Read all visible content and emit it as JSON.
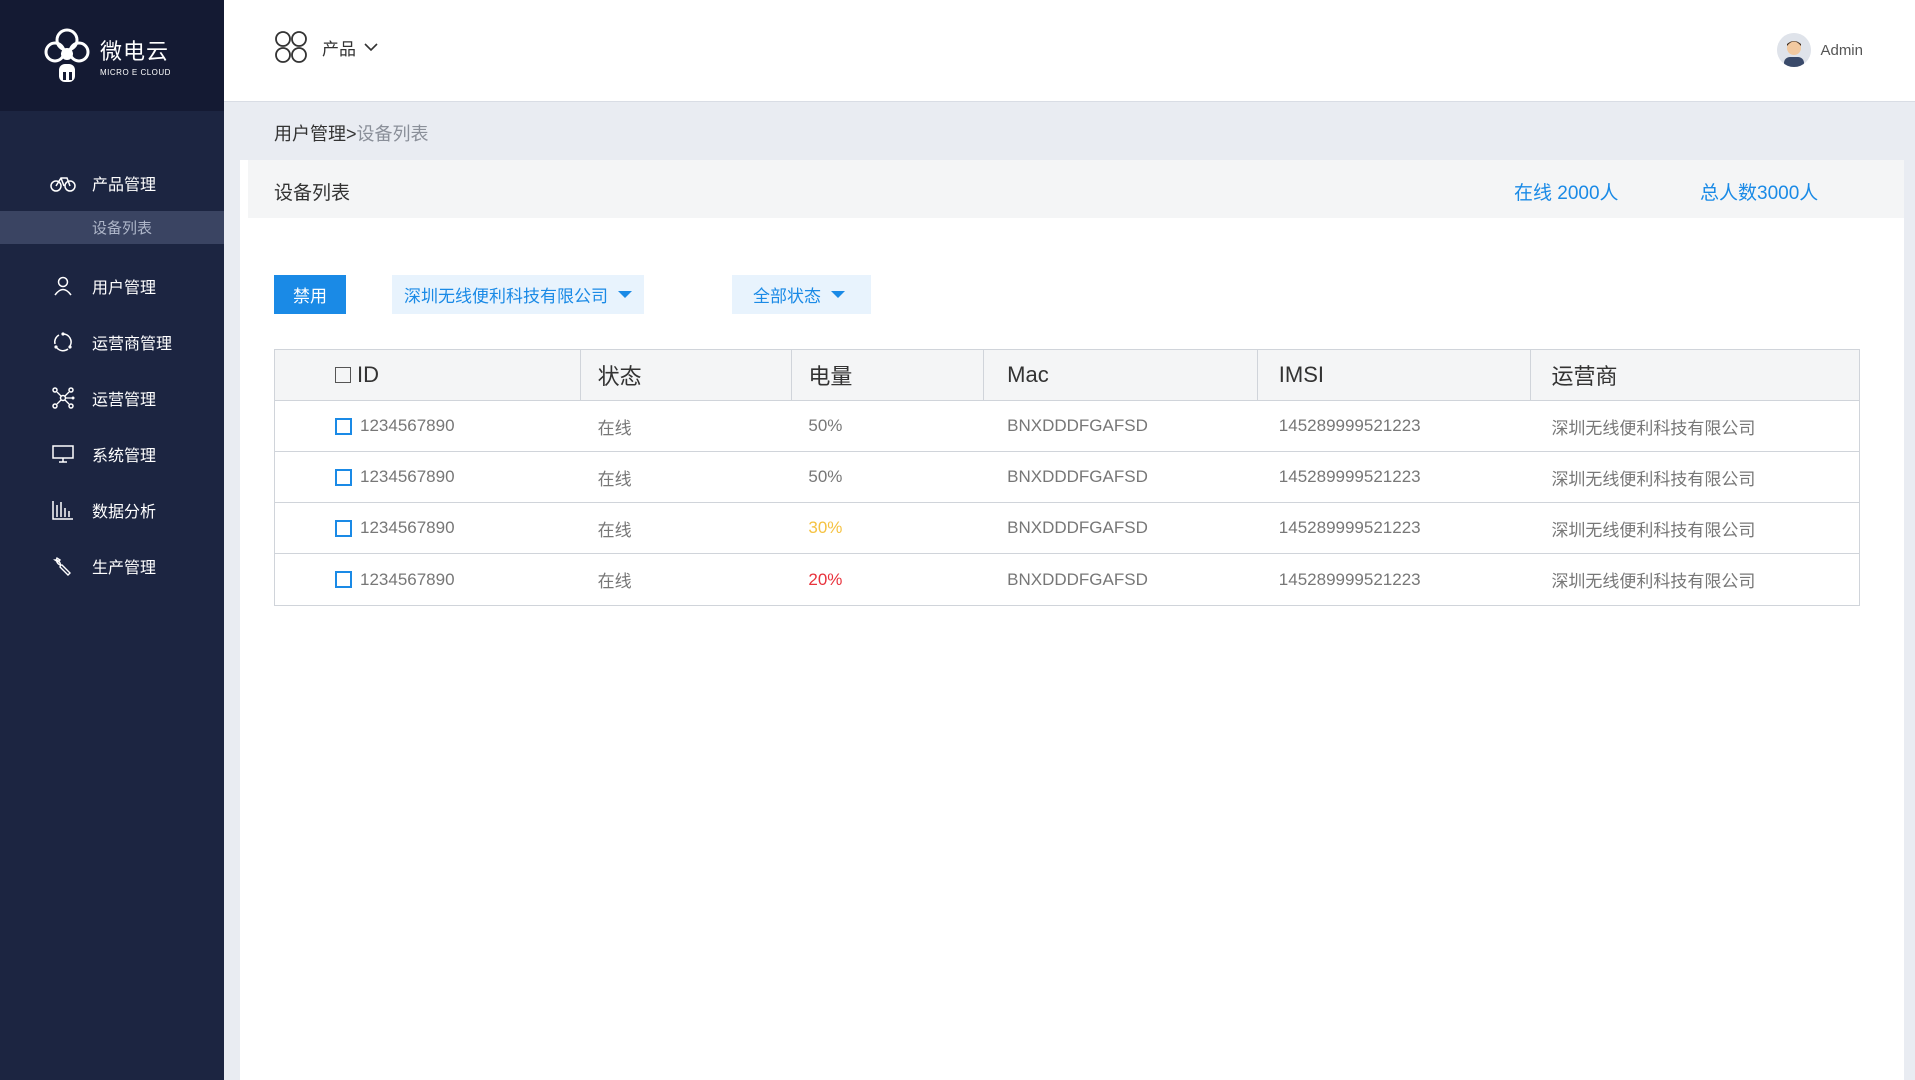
{
  "brand": {
    "name_cn": "微电云",
    "name_en": "MICRO E CLOUD"
  },
  "sidebar": {
    "items": [
      {
        "label": "产品管理",
        "icon": "bicycle-icon"
      },
      {
        "label": "用户管理",
        "icon": "user-icon"
      },
      {
        "label": "运营商管理",
        "icon": "cycle-icon"
      },
      {
        "label": "运营管理",
        "icon": "network-icon"
      },
      {
        "label": "系统管理",
        "icon": "monitor-icon"
      },
      {
        "label": "数据分析",
        "icon": "bar-chart-icon"
      },
      {
        "label": "生产管理",
        "icon": "wrench-icon"
      }
    ],
    "sub_item": "设备列表"
  },
  "header": {
    "product_label": "产品",
    "user_name": "Admin"
  },
  "breadcrumb": {
    "parent": "用户管理>",
    "current": "设备列表"
  },
  "card": {
    "title": "设备列表",
    "online": "在线 2000人",
    "total": "总人数3000人"
  },
  "toolbar": {
    "disable_label": "禁用",
    "company_select": "深圳无线便利科技有限公司",
    "status_select": "全部状态"
  },
  "table": {
    "headers": [
      "ID",
      "状态",
      "电量",
      "Mac",
      "IMSI",
      "运营商"
    ],
    "rows": [
      {
        "id": "1234567890",
        "status": "在线",
        "battery": "50%",
        "battery_color": "#777777",
        "mac": "BNXDDDFGAFSD",
        "imsi": "145289999521223",
        "operator": "深圳无线便利科技有限公司"
      },
      {
        "id": "1234567890",
        "status": "在线",
        "battery": "50%",
        "battery_color": "#777777",
        "mac": "BNXDDDFGAFSD",
        "imsi": "145289999521223",
        "operator": "深圳无线便利科技有限公司"
      },
      {
        "id": "1234567890",
        "status": "在线",
        "battery": "30%",
        "battery_color": "#f5c242",
        "mac": "BNXDDDFGAFSD",
        "imsi": "145289999521223",
        "operator": "深圳无线便利科技有限公司"
      },
      {
        "id": "1234567890",
        "status": "在线",
        "battery": "20%",
        "battery_color": "#e8323c",
        "mac": "BNXDDDFGAFSD",
        "imsi": "145289999521223",
        "operator": "深圳无线便利科技有限公司"
      }
    ]
  },
  "colors": {
    "accent": "#1a8ae6",
    "sidebar": "#1c2541",
    "warning": "#f5c242",
    "danger": "#e8323c"
  }
}
